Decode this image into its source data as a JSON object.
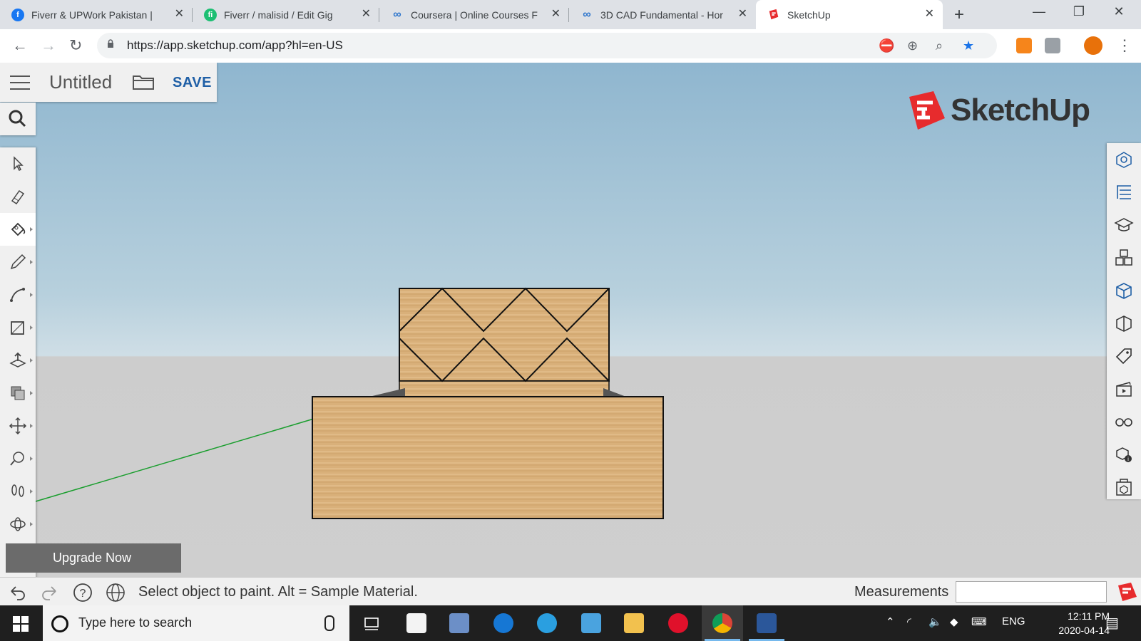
{
  "browser": {
    "tabs": [
      {
        "title": "Fiverr & UPWork Pakistan |",
        "favicon": "facebook-icon",
        "color": "#1877f2"
      },
      {
        "title": "Fiverr / malisid / Edit Gig",
        "favicon": "fiverr-icon",
        "color": "#1dbf73"
      },
      {
        "title": "Coursera | Online Courses F",
        "favicon": "coursera-icon",
        "color": "#2a73cc"
      },
      {
        "title": "3D CAD Fundamental - Hor",
        "favicon": "coursera-icon",
        "color": "#2a73cc"
      },
      {
        "title": "SketchUp",
        "favicon": "sketchup-icon",
        "color": "#e72b2d"
      }
    ],
    "url": "https://app.sketchup.com/app?hl=en-US"
  },
  "app": {
    "doc_title": "Untitled",
    "save_label": "SAVE",
    "logo_text": "SketchUp",
    "upgrade_label": "Upgrade Now",
    "status_text": "Select object to paint. Alt = Sample Material.",
    "measurements_label": "Measurements",
    "measurements_value": "",
    "active_tool": "paint-bucket",
    "tools": [
      "select",
      "eraser",
      "paint-bucket",
      "pencil",
      "arc",
      "rectangle",
      "push-pull",
      "offset",
      "move",
      "tape-measure",
      "walk",
      "orbit"
    ],
    "panels": [
      "entity-info",
      "outliner",
      "instructor",
      "components",
      "materials",
      "styles",
      "tags",
      "scenes",
      "display",
      "model-info",
      "solid-inspector"
    ]
  },
  "taskbar": {
    "search_placeholder": "Type here to search",
    "language": "ENG",
    "time": "12:11 PM",
    "date": "2020-04-14"
  },
  "colors": {
    "wood": "#d9b07a",
    "axis_green": "#1a9e2e",
    "save_blue": "#1f5fa6",
    "brand_red": "#e72b2d"
  }
}
